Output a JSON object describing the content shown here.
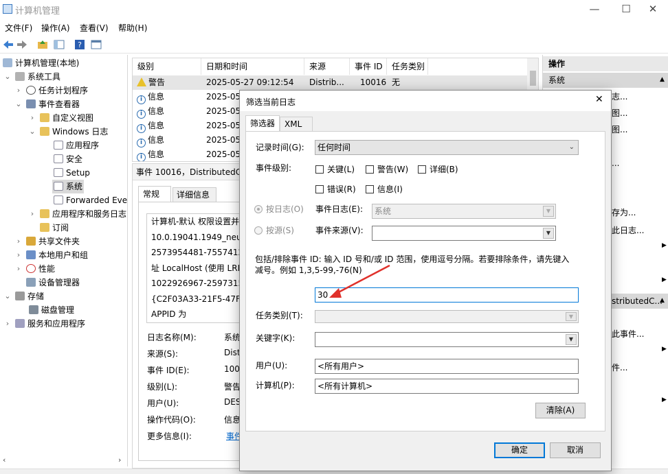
{
  "window": {
    "title": "计算机管理",
    "min": "—",
    "max": "☐",
    "close": "✕"
  },
  "menu": [
    "文件(F)",
    "操作(A)",
    "查看(V)",
    "帮助(H)"
  ],
  "tree": {
    "root": "计算机管理(本地)",
    "system_tools": "系统工具",
    "task_scheduler": "任务计划程序",
    "event_viewer": "事件查看器",
    "custom_views": "自定义视图",
    "windows_logs": "Windows 日志",
    "application": "应用程序",
    "security": "安全",
    "setup": "Setup",
    "system": "系统",
    "forwarded": "Forwarded Eve",
    "apps_services": "应用程序和服务日志",
    "subscriptions": "订阅",
    "shared_folders": "共享文件夹",
    "local_users": "本地用户和组",
    "performance": "性能",
    "device_manager": "设备管理器",
    "storage": "存储",
    "disk_mgmt": "磁盘管理",
    "services_apps": "服务和应用程序"
  },
  "list": {
    "headers": [
      "级别",
      "日期和时间",
      "来源",
      "事件 ID",
      "任务类别"
    ],
    "rows": [
      {
        "level": "警告",
        "date": "2025-05-27 09:12:54",
        "source": "Distrib...",
        "id": "10016",
        "cat": "无"
      },
      {
        "level": "信息",
        "date": "2025-05"
      },
      {
        "level": "信息",
        "date": "2025-05"
      },
      {
        "level": "信息",
        "date": "2025-05"
      },
      {
        "level": "信息",
        "date": "2025-05"
      },
      {
        "level": "信息",
        "date": "2025-05"
      }
    ]
  },
  "detail": {
    "title": "事件 10016，DistributedCO",
    "tab_general": "常规",
    "tab_details": "详细信息",
    "text_lines": [
      "计算机-默认 权限设置并",
      "10.0.19041.1949_neutr",
      "2573954481-75574123",
      "址 LocalHost (使用 LRP",
      "1022926967-25973157",
      "{C2F03A33-21F5-47FA-",
      "APPID 为"
    ],
    "props": [
      {
        "label": "日志名称(M):",
        "value": "系统"
      },
      {
        "label": "来源(S):",
        "value": "Dist"
      },
      {
        "label": "事件 ID(E):",
        "value": "100"
      },
      {
        "label": "级别(L):",
        "value": "警告"
      },
      {
        "label": "用户(U):",
        "value": "DES"
      },
      {
        "label": "操作代码(O):",
        "value": "信息"
      },
      {
        "label": "更多信息(I):",
        "value": "事件"
      }
    ]
  },
  "actions": {
    "header": "操作",
    "section1": "系统",
    "items1": [
      "志...",
      "图...",
      "图...",
      "...",
      "存为...",
      "此日志..."
    ],
    "section2": "stributedC...",
    "items2": [
      "此事件...",
      "件..."
    ]
  },
  "dialog": {
    "title": "筛选当前日志",
    "close": "✕",
    "tab_filter": "筛选器",
    "tab_xml": "XML",
    "logged_label": "记录时间(G):",
    "logged_value": "任何时间",
    "level_label": "事件级别:",
    "levels": [
      "关键(L)",
      "警告(W)",
      "详细(B)",
      "错误(R)",
      "信息(I)"
    ],
    "by_log": "按日志(O)",
    "by_source": "按源(S)",
    "event_logs_label": "事件日志(E):",
    "event_logs_value": "系统",
    "event_sources_label": "事件来源(V):",
    "include_text": "包括/排除事件 ID: 输入 ID 号和/或 ID 范围，使用逗号分隔。若要排除条件，请先键入",
    "include_text2": "减号。例如 1,3,5-99,-76(N)",
    "event_id_value": "30",
    "task_cat_label": "任务类别(T):",
    "keywords_label": "关键字(K):",
    "user_label": "用户(U):",
    "user_value": "<所有用户>",
    "computer_label": "计算机(P):",
    "computer_value": "<所有计算机>",
    "clear": "清除(A)",
    "ok": "确定",
    "cancel": "取消"
  },
  "colors": {
    "accent": "#0078d7",
    "arrow": "#e0312b",
    "selection": "#cce8ff"
  }
}
